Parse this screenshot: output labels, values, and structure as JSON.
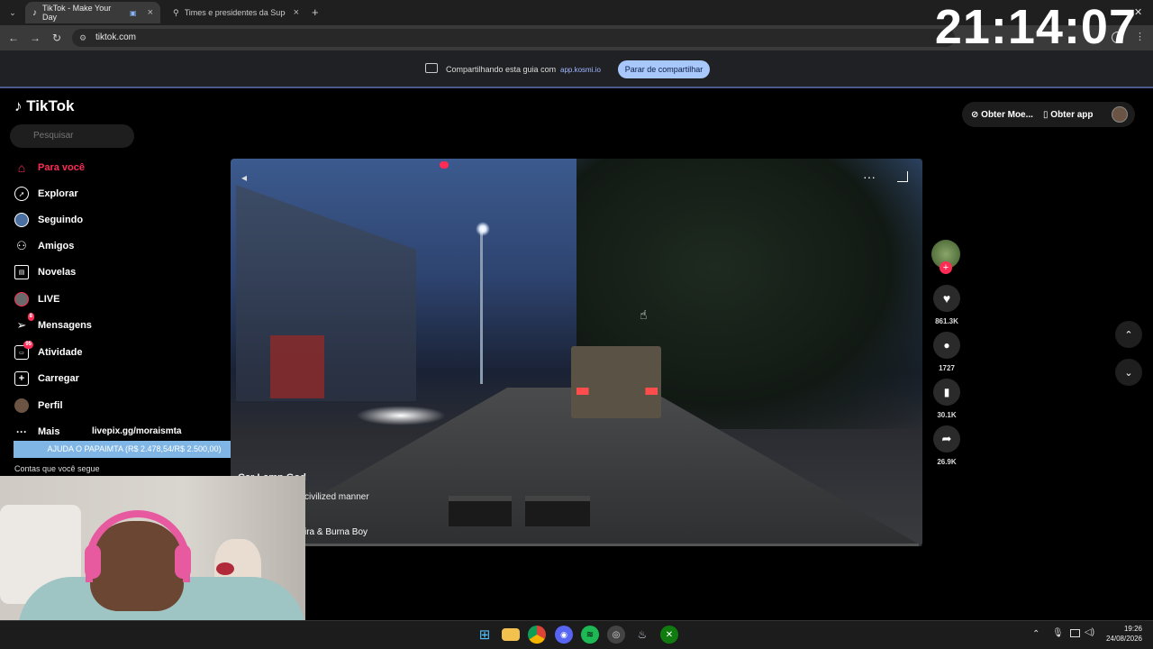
{
  "browser": {
    "tabs": [
      {
        "title": "TikTok - Make Your Day",
        "active": true
      },
      {
        "title": "Times e presidentes da Super C",
        "active": false
      }
    ],
    "new_tab": "+",
    "url": "tiktok.com",
    "close_window": "✕"
  },
  "overlay_clock": "21:14:07",
  "share_bar": {
    "text": "Compartilhando esta guia com",
    "host": "app.kosmi.io",
    "stop_button": "Parar de compartilhar"
  },
  "tiktok": {
    "logo": "TikTok",
    "search_placeholder": "Pesquisar",
    "nav": [
      {
        "label": "Para você",
        "icon": "home-icon",
        "active": true
      },
      {
        "label": "Explorar",
        "icon": "compass-icon"
      },
      {
        "label": "Seguindo",
        "icon": "following-icon"
      },
      {
        "label": "Amigos",
        "icon": "friends-icon"
      },
      {
        "label": "Novelas",
        "icon": "novelas-icon"
      },
      {
        "label": "LIVE",
        "icon": "live-icon"
      },
      {
        "label": "Mensagens",
        "icon": "messages-icon",
        "badge": "8"
      },
      {
        "label": "Atividade",
        "icon": "activity-icon",
        "badge": "95"
      },
      {
        "label": "Carregar",
        "icon": "upload-icon"
      },
      {
        "label": "Perfil",
        "icon": "profile-icon"
      },
      {
        "label": "Mais",
        "icon": "more-icon"
      }
    ],
    "following_accounts": "Contas que você segue",
    "top_right": {
      "coins": "Obter Moe...",
      "app": "Obter app"
    },
    "video": {
      "author": "Car Lamp God",
      "caption": "civilized manner",
      "music": "ira & Burna Boy",
      "progress": 0.0
    },
    "actions": {
      "likes": "861.3K",
      "comments": "1727",
      "saves": "30.1K",
      "shares": "26.9K"
    }
  },
  "stream_overlay": {
    "donation_url": "livepix.gg/moraismta",
    "donation_bar": "AJUDA O PAPAIMTA (R$ 2.478,54/R$ 2.500,00)",
    "donation_progress": 0.991
  },
  "taskbar": {
    "time": "19:26",
    "date": "24/08/2026"
  },
  "colors": {
    "tiktok_accent": "#fe2c55",
    "share_button": "#a8c7fa",
    "donation_bar": "#7fb6e6"
  }
}
